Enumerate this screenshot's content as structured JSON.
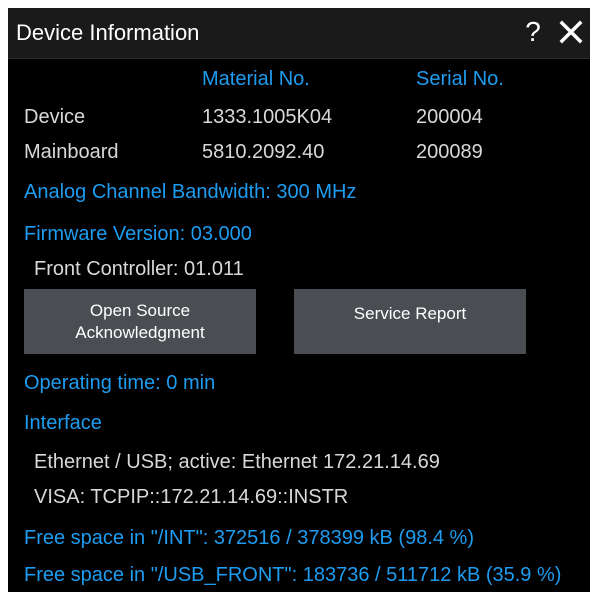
{
  "dialog": {
    "title": "Device Information",
    "help_label": "?",
    "close_icon": "close-icon"
  },
  "table": {
    "headers": {
      "material": "Material No.",
      "serial": "Serial No."
    },
    "rows": [
      {
        "label": "Device",
        "material": "1333.1005K04",
        "serial": "200004"
      },
      {
        "label": "Mainboard",
        "material": "5810.2092.40",
        "serial": "200089"
      }
    ]
  },
  "bandwidth": "Analog Channel Bandwidth: 300 MHz",
  "firmware": {
    "version": "Firmware Version: 03.000",
    "front_controller": "Front Controller: 01.011"
  },
  "buttons": {
    "open_source_line1": "Open Source",
    "open_source_line2": "Acknowledgment",
    "service_report": "Service Report"
  },
  "operating_time": "Operating time: 0 min",
  "interface": {
    "heading": "Interface",
    "active": "Ethernet / USB; active: Ethernet 172.21.14.69",
    "visa": "VISA: TCPIP::172.21.14.69::INSTR"
  },
  "storage": {
    "int": "Free space in \"/INT\": 372516 / 378399 kB (98.4 %)",
    "usb_front": "Free space in \"/USB_FRONT\": 183736 / 511712 kB (35.9 %)"
  },
  "colors": {
    "accent": "#1e9cf0",
    "background": "#000000",
    "button": "#4a4e53"
  }
}
